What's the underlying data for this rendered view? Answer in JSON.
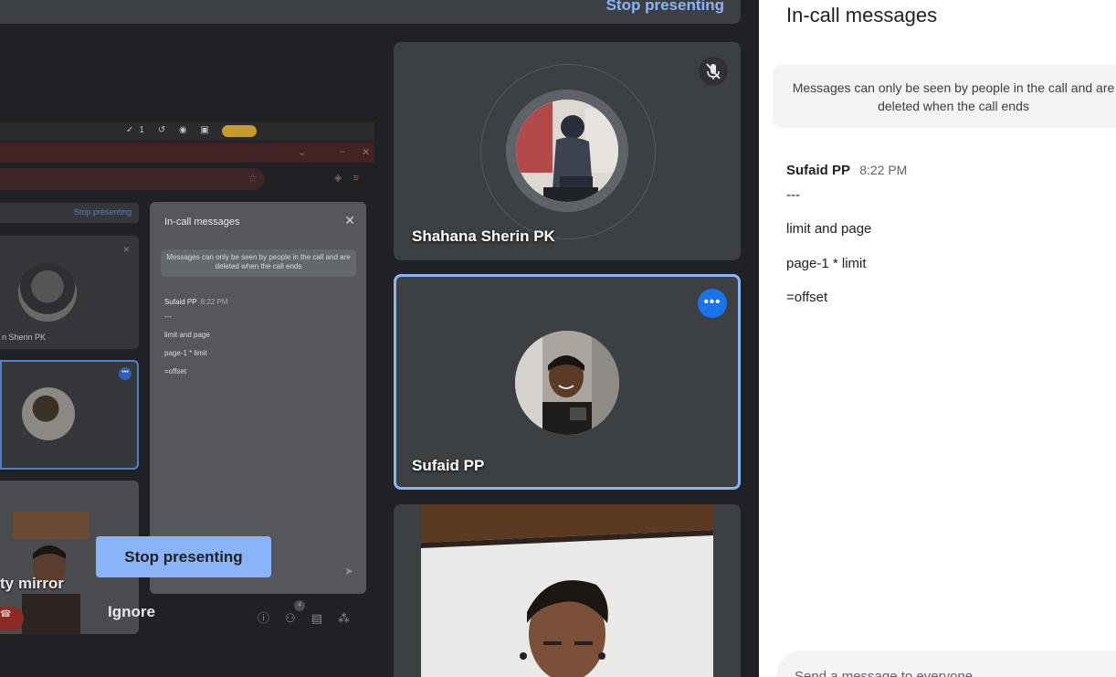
{
  "presentation": {
    "top_stop_label": "Stop presenting",
    "overlay_stop_label": "Stop presenting",
    "overlay_ignore_label": "Ignore",
    "overlay_name": "ty mirror"
  },
  "mirror": {
    "stop_label": "Stop presenting",
    "tiles": [
      {
        "name": "n Sherin PK"
      }
    ],
    "chat": {
      "title": "In-call messages",
      "note": "Messages can only be seen by people in the call and are deleted when the call ends",
      "sender": "Sufaid PP",
      "time": "8:22 PM",
      "lines": [
        "---",
        "limit and page",
        "page-1 * limit",
        "=offset"
      ]
    },
    "status_glyphs": "✓1 ↺ ◉ ▣",
    "participant_badge": "4"
  },
  "participants": [
    {
      "name": "Shahana Sherin PK",
      "muted": true
    },
    {
      "name": "Sufaid PP",
      "muted": false,
      "active": true
    },
    {
      "name": "",
      "video_on": true
    }
  ],
  "chat": {
    "title": "In-call messages",
    "notice": "Messages can only be seen by people in the call and are deleted when the call ends",
    "messages": [
      {
        "sender": "Sufaid PP",
        "time": "8:22 PM",
        "lines": [
          "---",
          "limit and page",
          "page-1 * limit",
          "=offset"
        ]
      }
    ],
    "input_placeholder": "Send a message to everyone"
  },
  "colors": {
    "accent": "#8ab4f8",
    "active_blue": "#1a73e8",
    "background": "#202124",
    "tile": "#3c4043"
  },
  "icons": [
    "mic-off-icon",
    "more-options-icon",
    "close-icon",
    "send-icon",
    "end-call-icon",
    "info-icon",
    "people-icon",
    "chat-icon",
    "activities-icon"
  ]
}
